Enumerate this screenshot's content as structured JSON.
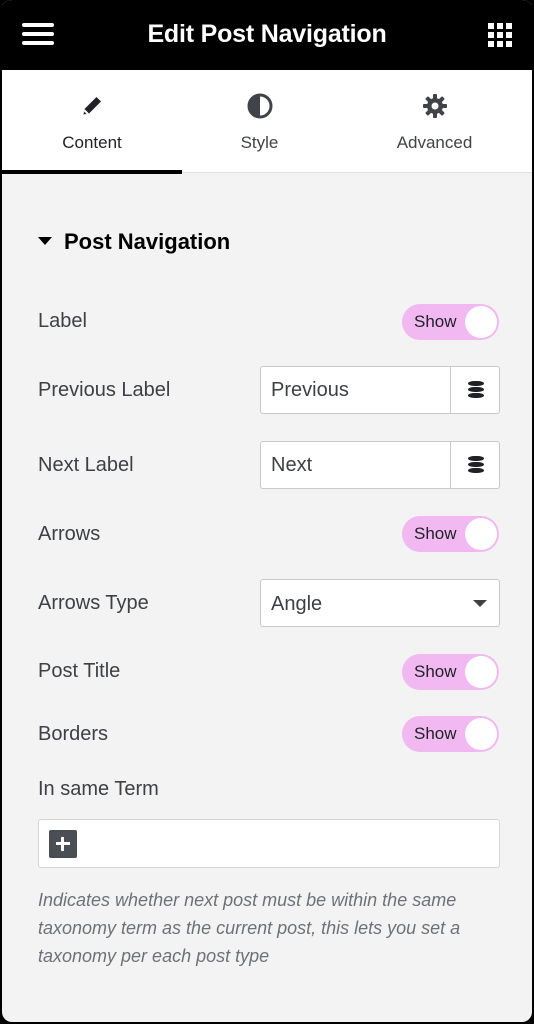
{
  "header": {
    "title": "Edit Post Navigation",
    "menu_icon": "hamburger-icon",
    "apps_icon": "grid-icon"
  },
  "tabs": [
    {
      "label": "Content",
      "icon": "pencil-icon",
      "active": true
    },
    {
      "label": "Style",
      "icon": "contrast-icon",
      "active": false
    },
    {
      "label": "Advanced",
      "icon": "gear-icon",
      "active": false
    }
  ],
  "section": {
    "title": "Post Navigation"
  },
  "controls": {
    "label": {
      "label": "Label",
      "toggle": "Show"
    },
    "previous_label": {
      "label": "Previous Label",
      "value": "Previous"
    },
    "next_label": {
      "label": "Next Label",
      "value": "Next"
    },
    "arrows": {
      "label": "Arrows",
      "toggle": "Show"
    },
    "arrows_type": {
      "label": "Arrows Type",
      "value": "Angle"
    },
    "post_title": {
      "label": "Post Title",
      "toggle": "Show"
    },
    "borders": {
      "label": "Borders",
      "toggle": "Show"
    },
    "in_same_term": {
      "label": "In same Term"
    }
  },
  "help_text": "Indicates whether next post must be within the same taxonomy term as the current post, this lets you set a taxonomy per each post type",
  "colors": {
    "toggle_on": "#f2b8f2",
    "header_bg": "#000000",
    "panel_bg": "#f3f3f3"
  }
}
